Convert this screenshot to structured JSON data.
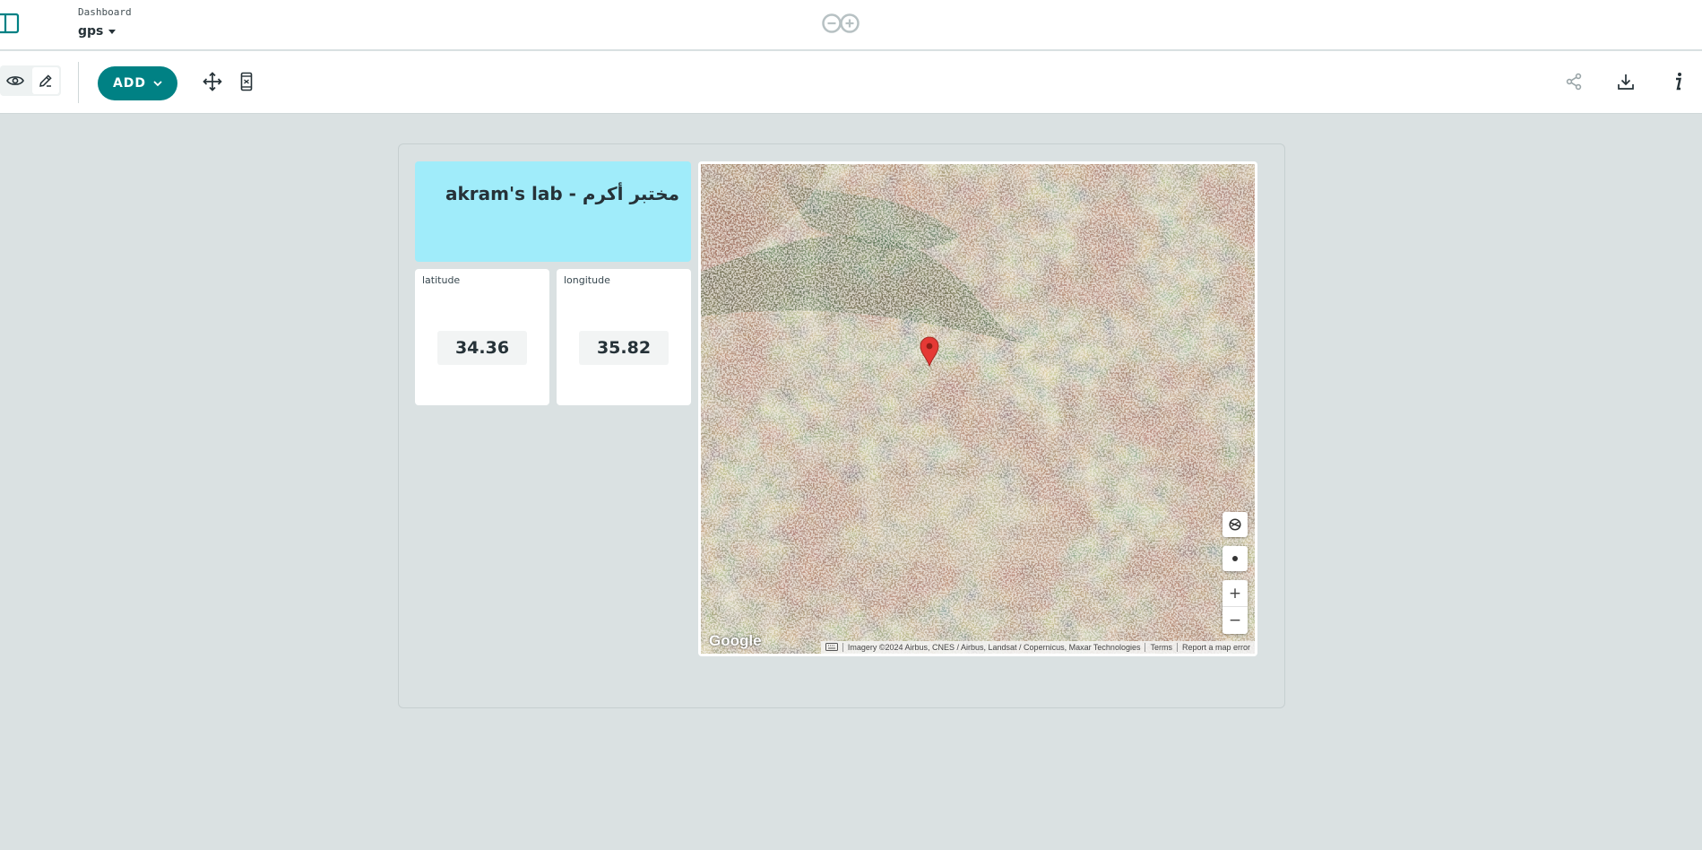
{
  "header": {
    "breadcrumb": "Dashboard",
    "dashboard_name": "gps"
  },
  "toolbar": {
    "add_label": "ADD",
    "icons": [
      "eye-icon",
      "pencil-icon",
      "move-arrows-icon",
      "mobile-view-icon",
      "share-icon",
      "download-icon",
      "info-icon"
    ]
  },
  "board": {
    "title_widget": {
      "text": "akram's lab - مختبر أكرم",
      "background": "#a0ecfa"
    },
    "latitude": {
      "label": "latitude",
      "value": "34.36"
    },
    "longitude": {
      "label": "longitude",
      "value": "35.82"
    },
    "map": {
      "provider_logo": "Google",
      "attribution": "Imagery ©2024 Airbus, CNES / Airbus, Landsat / Copernicus, Maxar Technologies",
      "terms": "Terms",
      "report": "Report a map error",
      "zoom_in": "+",
      "zoom_out": "−",
      "marker_color": "#e53935"
    }
  },
  "colors": {
    "accent": "#008184",
    "background": "#dae1e2"
  }
}
